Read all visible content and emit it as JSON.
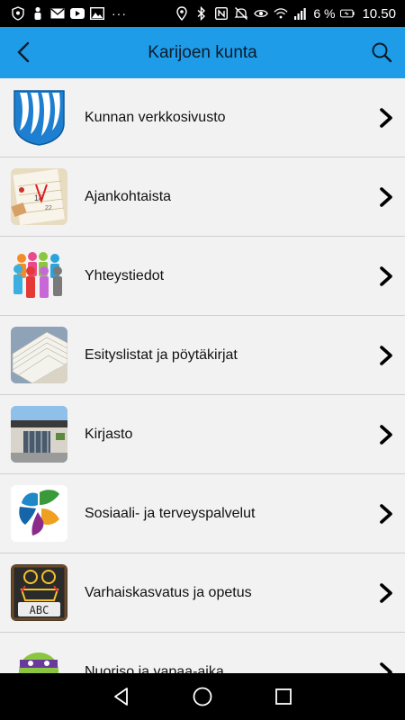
{
  "statusbar": {
    "left_icons": [
      "shield-icon",
      "person-icon",
      "mail-icon",
      "youtube-icon",
      "image-icon"
    ],
    "more": "···",
    "right_icons": [
      "location-icon",
      "bluetooth-icon",
      "nfc-icon",
      "mute-icon",
      "eye-icon",
      "wifi-icon",
      "signal-icon"
    ],
    "battery_text": "6 %",
    "time": "10.50"
  },
  "toolbar": {
    "title": "Karijoen kunta",
    "background": "#1e9ce8"
  },
  "list": {
    "items": [
      {
        "label": "Kunnan verkkosivusto",
        "icon": "municipality-crest-icon"
      },
      {
        "label": "Ajankohtaista",
        "icon": "calendar-icon"
      },
      {
        "label": "Yhteystiedot",
        "icon": "people-icon"
      },
      {
        "label": "Esityslistat ja pöytäkirjat",
        "icon": "documents-icon"
      },
      {
        "label": "Kirjasto",
        "icon": "library-building-icon"
      },
      {
        "label": "Sosiaali- ja terveyspalvelut",
        "icon": "social-health-logo-icon"
      },
      {
        "label": "Varhaiskasvatus ja opetus",
        "icon": "chalkboard-abc-icon"
      },
      {
        "label": "Nuoriso ja vapaa-aika",
        "icon": "turtle-character-icon"
      }
    ]
  }
}
